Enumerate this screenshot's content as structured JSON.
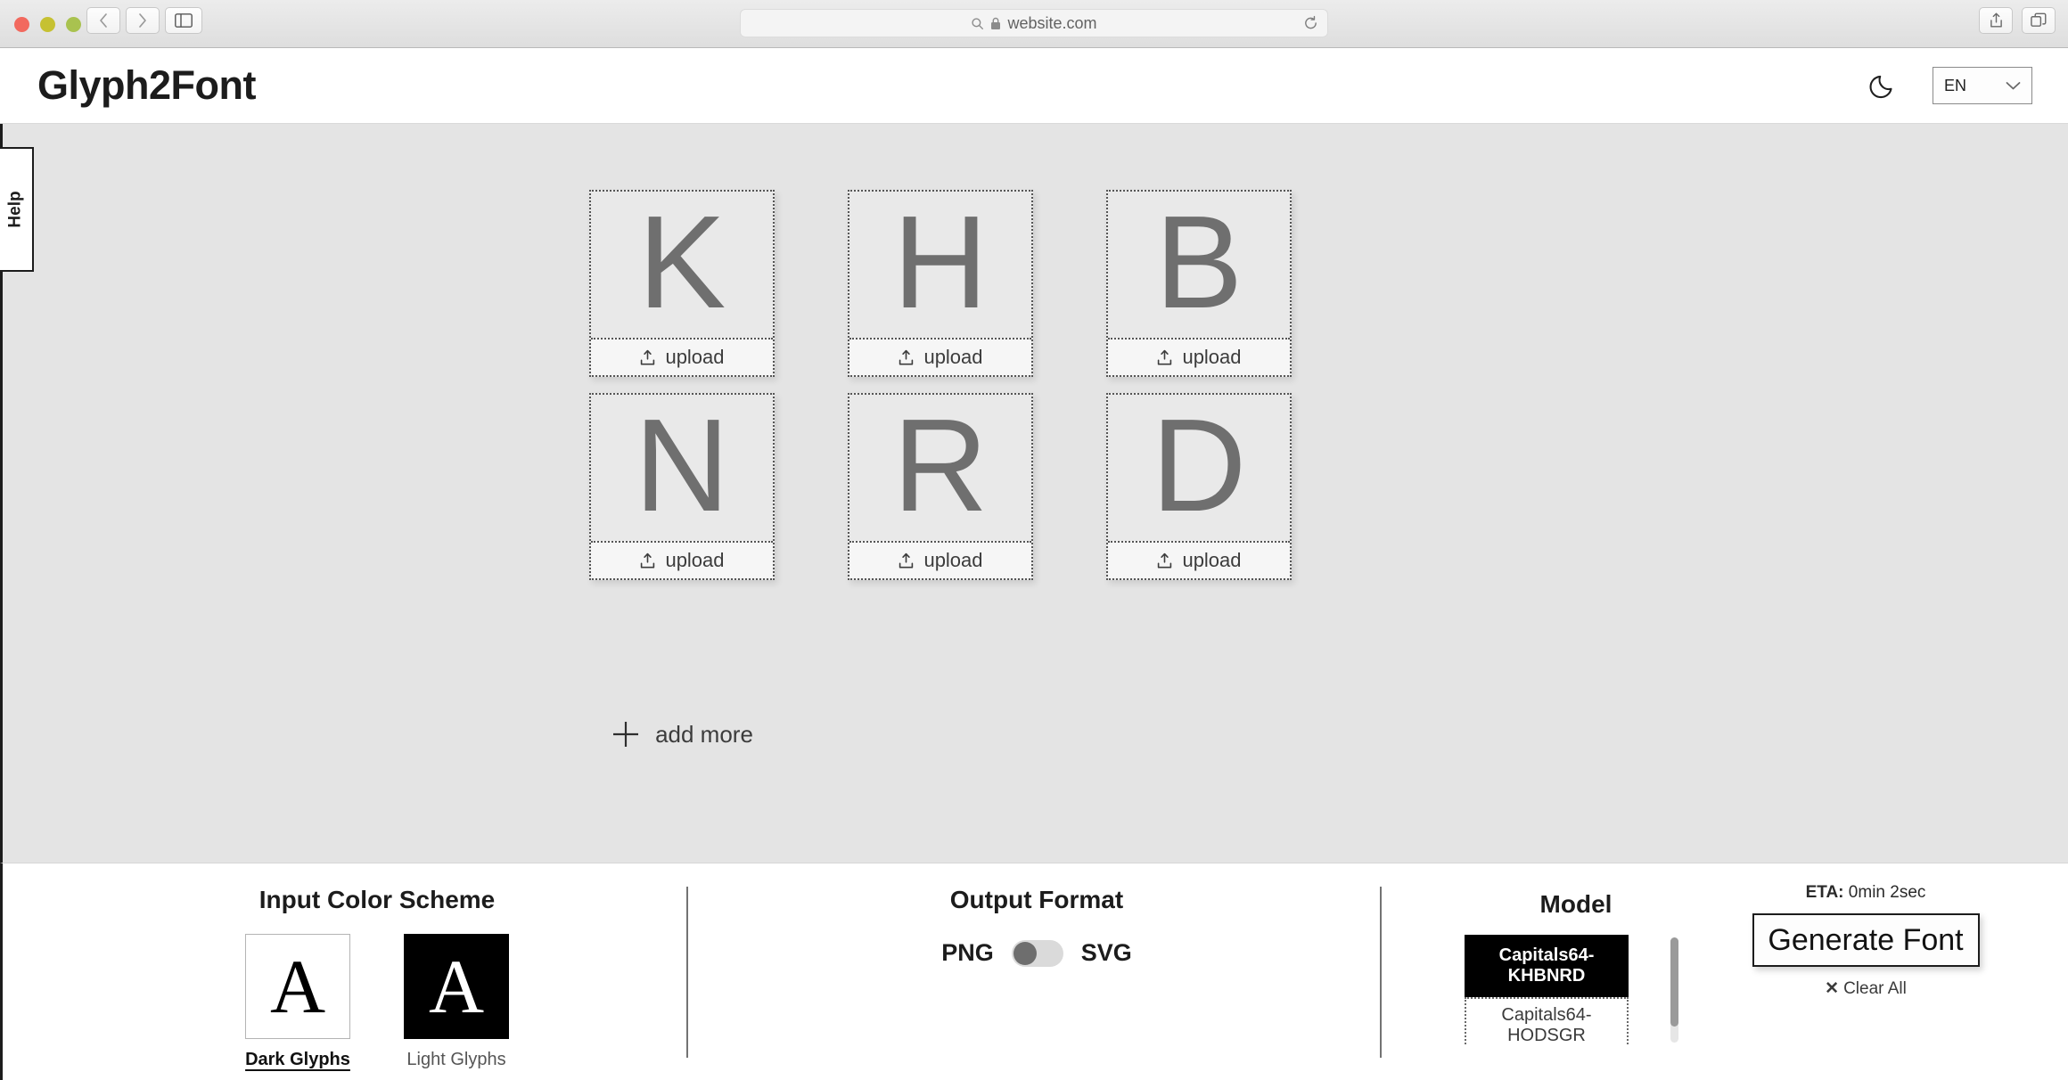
{
  "browser": {
    "traffic_lights": [
      "close",
      "minimize",
      "maximize"
    ],
    "back_label": "Back",
    "forward_label": "Forward",
    "sidebar_label": "Show Sidebar",
    "url": "website.com",
    "reload_label": "Reload",
    "share_label": "Share",
    "tabs_label": "Show Tab Overview"
  },
  "header": {
    "title": "Glyph2Font",
    "dark_mode_label": "Dark Mode",
    "language": "EN"
  },
  "sidebar": {
    "help_label": "Help"
  },
  "main": {
    "glyphs": [
      {
        "letter": "K",
        "upload_label": "upload"
      },
      {
        "letter": "H",
        "upload_label": "upload"
      },
      {
        "letter": "B",
        "upload_label": "upload"
      },
      {
        "letter": "N",
        "upload_label": "upload"
      },
      {
        "letter": "R",
        "upload_label": "upload"
      },
      {
        "letter": "D",
        "upload_label": "upload"
      }
    ],
    "add_more_label": "add more"
  },
  "footer": {
    "input_color_scheme": {
      "title": "Input Color Scheme",
      "options": [
        {
          "glyph": "A",
          "label": "Dark Glyphs",
          "selected": true
        },
        {
          "glyph": "A",
          "label": "Light Glyphs",
          "selected": false
        }
      ]
    },
    "output_format": {
      "title": "Output Format",
      "left_label": "PNG",
      "right_label": "SVG",
      "selected": "PNG"
    },
    "model": {
      "title": "Model",
      "items": [
        {
          "label": "Capitals64-KHBNRD",
          "selected": true
        },
        {
          "label": "Capitals64-HODSGR",
          "selected": false
        }
      ]
    },
    "generate": {
      "eta_prefix": "ETA:",
      "eta_value": "0min 2sec",
      "button_label": "Generate Font",
      "clear_label": "Clear All",
      "clear_icon": "✕"
    }
  },
  "colors": {
    "content_bg": "#e4e4e4",
    "accent_dark": "#1c1c1c",
    "glyph_gray": "#6f6f6f"
  }
}
